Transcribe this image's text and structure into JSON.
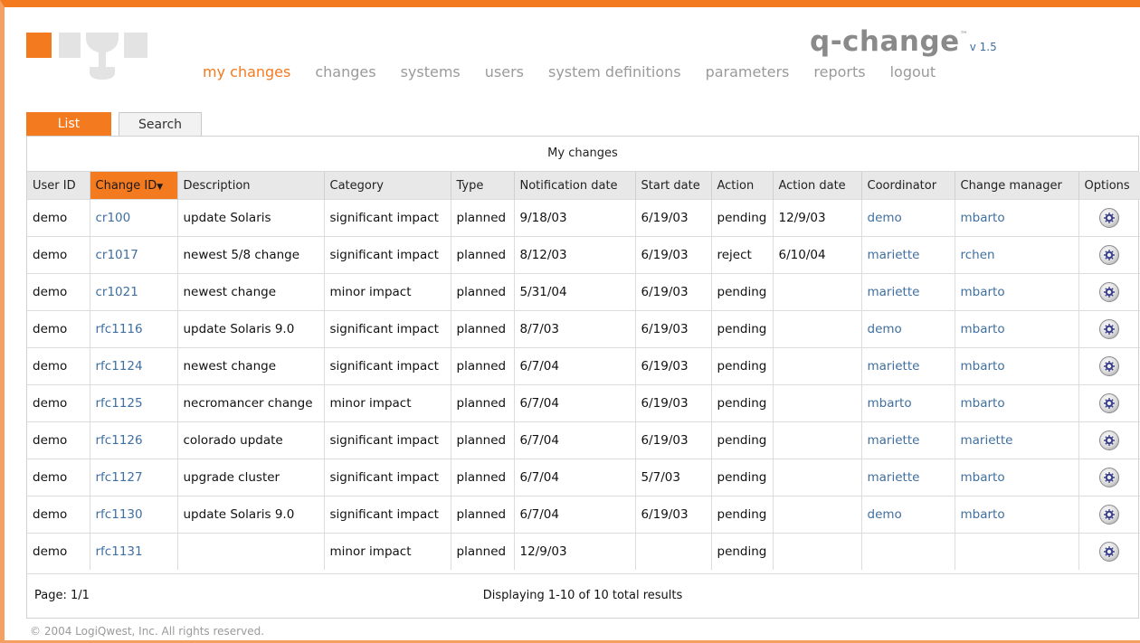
{
  "brand": {
    "name": "q-change",
    "tm": "™",
    "version": "v 1.5"
  },
  "nav": [
    {
      "label": "my changes",
      "active": true
    },
    {
      "label": "changes"
    },
    {
      "label": "systems"
    },
    {
      "label": "users"
    },
    {
      "label": "system definitions"
    },
    {
      "label": "parameters"
    },
    {
      "label": "reports"
    },
    {
      "label": "logout"
    }
  ],
  "tabs": {
    "list": "List",
    "search": "Search"
  },
  "table": {
    "caption": "My changes",
    "columns": [
      "User ID",
      "Change ID",
      "Description",
      "Category",
      "Type",
      "Notification date",
      "Start date",
      "Action",
      "Action date",
      "Coordinator",
      "Change manager",
      "Options"
    ],
    "sort_indicator": "▼",
    "rows": [
      [
        "demo",
        "cr100",
        "update Solaris",
        "significant impact",
        "planned",
        "9/18/03",
        "6/19/03",
        "pending",
        "12/9/03",
        "demo",
        "mbarto"
      ],
      [
        "demo",
        "cr1017",
        "newest 5/8 change",
        "significant impact",
        "planned",
        "8/12/03",
        "6/19/03",
        "reject",
        "6/10/04",
        "mariette",
        "rchen"
      ],
      [
        "demo",
        "cr1021",
        "newest change",
        "minor impact",
        "planned",
        "5/31/04",
        "6/19/03",
        "pending",
        "",
        "mariette",
        "mbarto"
      ],
      [
        "demo",
        "rfc1116",
        "update Solaris 9.0",
        "significant impact",
        "planned",
        "8/7/03",
        "6/19/03",
        "pending",
        "",
        "demo",
        "mbarto"
      ],
      [
        "demo",
        "rfc1124",
        "newest change",
        "significant impact",
        "planned",
        "6/7/04",
        "6/19/03",
        "pending",
        "",
        "mariette",
        "mbarto"
      ],
      [
        "demo",
        "rfc1125",
        "necromancer change",
        "minor impact",
        "planned",
        "6/7/04",
        "6/19/03",
        "pending",
        "",
        "mbarto",
        "mbarto"
      ],
      [
        "demo",
        "rfc1126",
        "colorado update",
        "significant impact",
        "planned",
        "6/7/04",
        "6/19/03",
        "pending",
        "",
        "mariette",
        "mariette"
      ],
      [
        "demo",
        "rfc1127",
        "upgrade cluster",
        "significant impact",
        "planned",
        "6/7/04",
        "5/7/03",
        "pending",
        "",
        "mariette",
        "mbarto"
      ],
      [
        "demo",
        "rfc1130",
        "update Solaris 9.0",
        "significant impact",
        "planned",
        "6/7/04",
        "6/19/03",
        "pending",
        "",
        "demo",
        "mbarto"
      ],
      [
        "demo",
        "rfc1131",
        "",
        "minor impact",
        "planned",
        "12/9/03",
        "",
        "pending",
        "",
        "",
        ""
      ]
    ]
  },
  "pager": {
    "page": "Page: 1/1",
    "display": "Displaying 1-10 of 10 total results"
  },
  "footer": {
    "copyright": "© 2004  LogiQwest, Inc. All rights reserved."
  },
  "colors": {
    "accent": "#f47a20",
    "link": "#3f6fa0",
    "nav": "#9a9a9a"
  },
  "icons": {
    "options": "options-gear-icon",
    "sort": "sort-descending-icon"
  }
}
